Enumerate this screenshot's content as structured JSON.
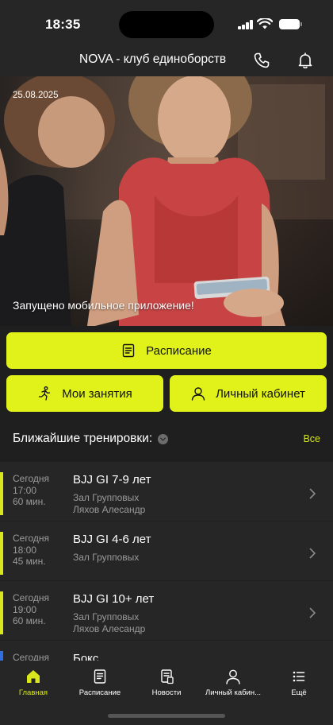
{
  "status_bar": {
    "time": "18:35"
  },
  "header": {
    "title": "NOVA - клуб единоборств",
    "phone_icon": "phone-icon",
    "bell_icon": "bell-icon"
  },
  "hero": {
    "date": "25.08.2025",
    "caption": "Запущено мобильное приложение!"
  },
  "buttons": {
    "schedule": {
      "label": "Расписание",
      "icon": "document-icon"
    },
    "my_classes": {
      "label": "Мои занятия",
      "icon": "runner-icon"
    },
    "cabinet": {
      "label": "Личный кабинет",
      "icon": "user-icon"
    }
  },
  "upcoming": {
    "title": "Ближайшие тренировки:",
    "see_all": "Все",
    "items": [
      {
        "day": "Сегодня",
        "time": "17:00",
        "duration": "60 мин.",
        "name": "BJJ GI 7-9 лет",
        "hall": "Зал Групповых",
        "coach": "Ляхов Алесандр",
        "accent": "#d9e81c"
      },
      {
        "day": "Сегодня",
        "time": "18:00",
        "duration": "45 мин.",
        "name": "BJJ GI  4-6 лет",
        "hall": "Зал Групповых",
        "coach": "",
        "accent": "#d9e81c"
      },
      {
        "day": "Сегодня",
        "time": "19:00",
        "duration": "60 мин.",
        "name": "BJJ GI  10+ лет",
        "hall": "Зал Групповых",
        "coach": "Ляхов Алесандр",
        "accent": "#d9e81c"
      },
      {
        "day": "Сегодня",
        "time": "",
        "duration": "",
        "name": "Бокс",
        "hall": "",
        "coach": "",
        "accent": "#2f6fe0"
      }
    ]
  },
  "tabbar": {
    "tabs": [
      {
        "label": "Главная",
        "icon": "home-icon",
        "active": true
      },
      {
        "label": "Расписание",
        "icon": "document-icon",
        "active": false
      },
      {
        "label": "Новости",
        "icon": "news-icon",
        "active": false
      },
      {
        "label": "Личный кабин...",
        "icon": "user-icon",
        "active": false
      },
      {
        "label": "Ещё",
        "icon": "menu-list-icon",
        "active": false
      }
    ]
  },
  "colors": {
    "accent": "#e1f21a",
    "background": "#1f1f1f",
    "surface": "#262626",
    "muted_text": "#9a9a9a"
  }
}
